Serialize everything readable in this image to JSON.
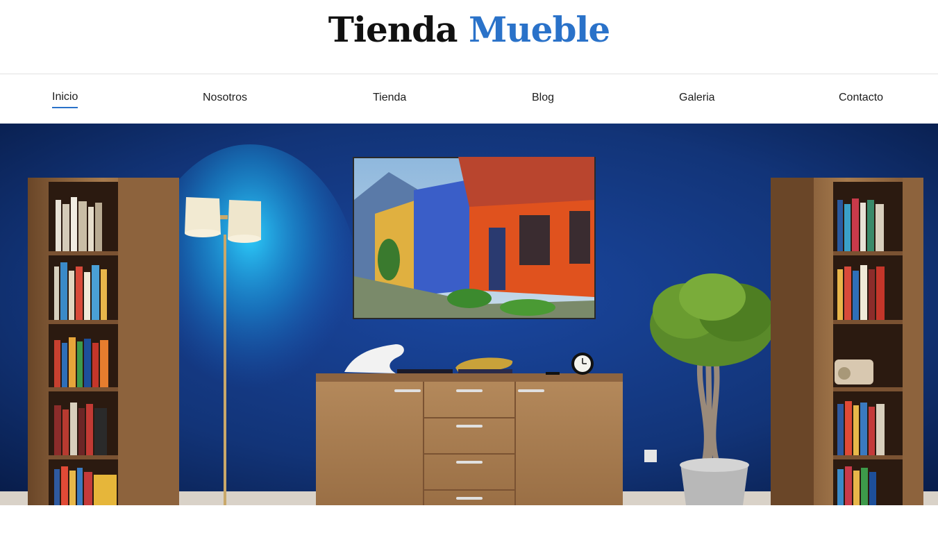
{
  "header": {
    "logo_part1": "Tienda",
    "logo_part2": "Mueble"
  },
  "nav": {
    "items": [
      {
        "label": "Inicio",
        "active": true
      },
      {
        "label": "Nosotros"
      },
      {
        "label": "Tienda"
      },
      {
        "label": "Blog"
      },
      {
        "label": "Galeria"
      },
      {
        "label": "Contacto"
      }
    ]
  },
  "colors": {
    "accent": "#2a72c9",
    "wall": "#14337a",
    "wood": "#a0744a"
  },
  "hero": {
    "image": "living-room-blue-wall-with-sideboard-painting-lamp-bookshelves-plant"
  }
}
